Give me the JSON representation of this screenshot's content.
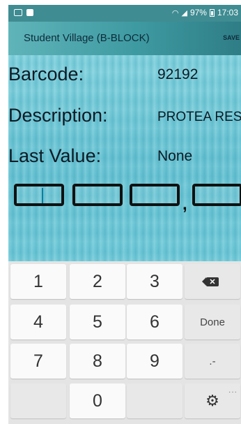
{
  "status_bar": {
    "battery": "97%",
    "time": "17:03",
    "icons": [
      "message-icon",
      "image-icon",
      "wifi-icon",
      "signal-icon",
      "battery-icon"
    ]
  },
  "app_bar": {
    "title": "Student Village (B-BLOCK)",
    "save_label": "SAVE"
  },
  "fields": {
    "barcode_label": "Barcode:",
    "barcode_value": "92192",
    "description_label": "Description:",
    "description_value": "PROTEA RES",
    "last_value_label": "Last Value:",
    "last_value_value": "None"
  },
  "reading_input": {
    "decimal_separator": ","
  },
  "keypad": {
    "keys": [
      "1",
      "2",
      "3",
      "4",
      "5",
      "6",
      "7",
      "8",
      "9",
      "0"
    ],
    "done_label": "Done",
    "punct_label": ".-",
    "backspace_icon": "backspace-icon",
    "settings_icon": "gear-icon",
    "more_label": "..."
  },
  "colors": {
    "accent": "#3f8c92",
    "background": "#6cc7d6",
    "keypad": "#e4e4e4"
  }
}
